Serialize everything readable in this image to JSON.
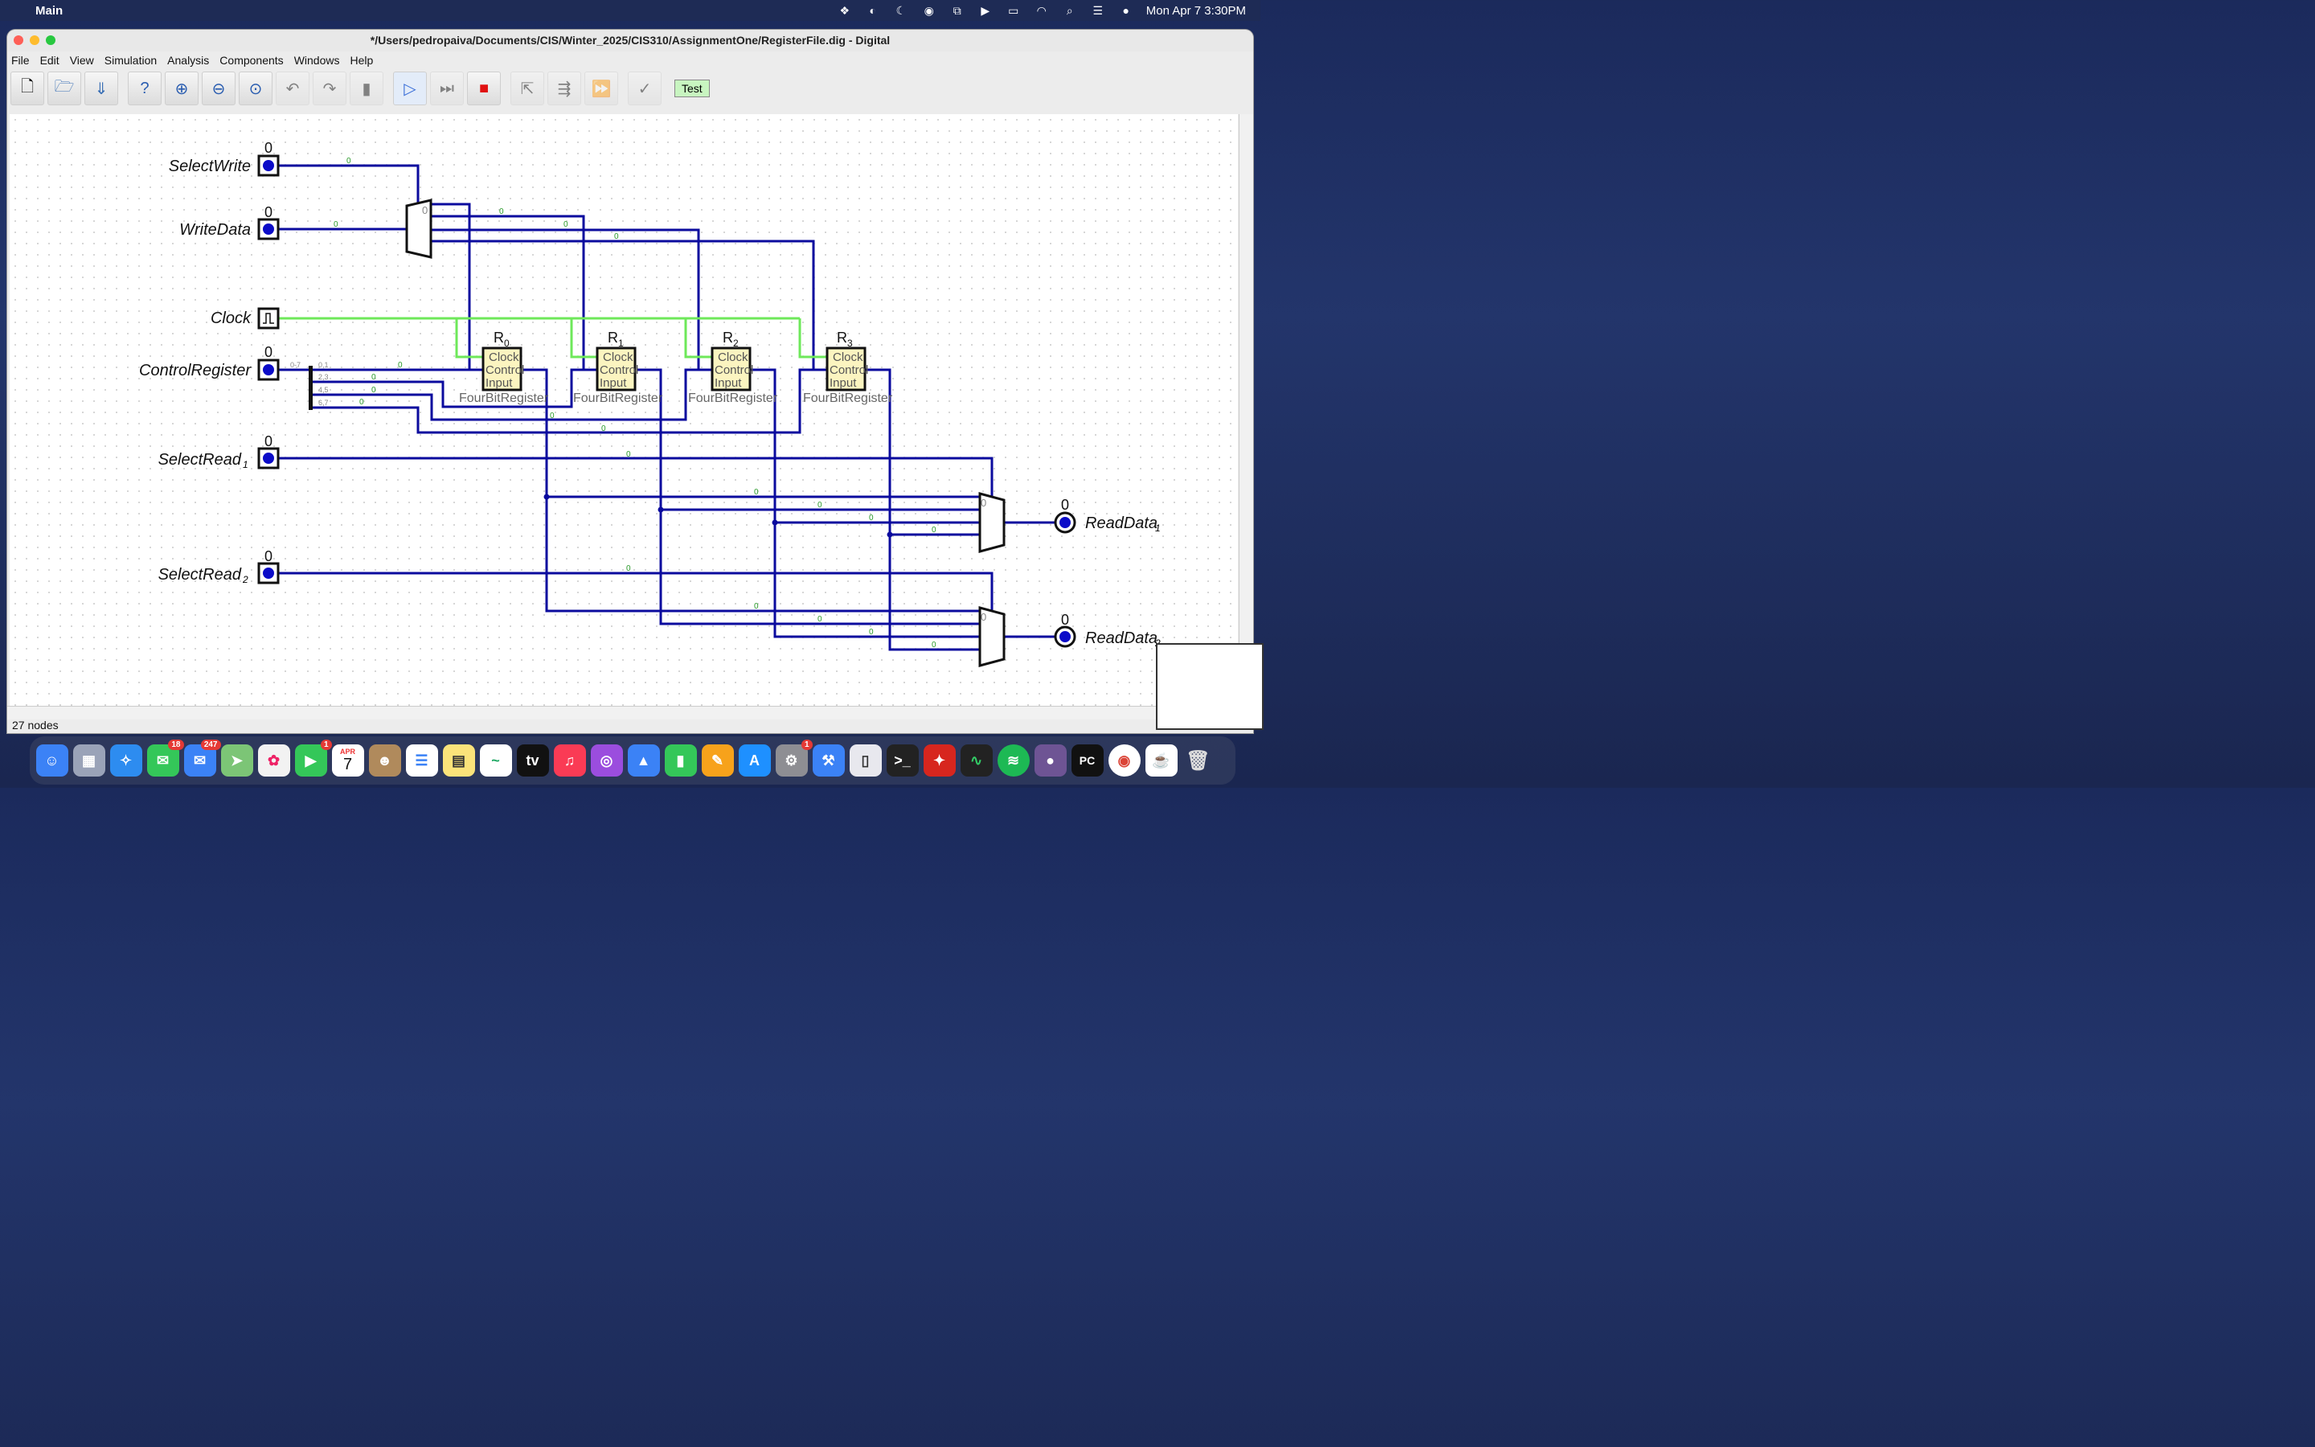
{
  "menubar": {
    "app_name": "Main",
    "datetime": "Mon Apr 7  3:30PM",
    "icons": [
      "dropbox-icon",
      "globe-icon",
      "moon-icon",
      "airdrop-icon",
      "screen-mirror-icon",
      "play-icon",
      "battery-icon",
      "wifi-icon",
      "search-icon",
      "control-center-icon",
      "siri-icon"
    ]
  },
  "window": {
    "title": "*/Users/pedropaiva/Documents/CIS/Winter_2025/CIS310/AssignmentOne/RegisterFile.dig - Digital"
  },
  "menu": [
    "File",
    "Edit",
    "View",
    "Simulation",
    "Analysis",
    "Components",
    "Windows",
    "Help"
  ],
  "toolbar": {
    "test_label": "Test",
    "buttons": [
      "new-file-icon",
      "open-folder-icon",
      "save-icon",
      "help-icon",
      "zoom-in-icon",
      "zoom-out-icon",
      "zoom-fit-icon",
      "undo-icon",
      "redo-icon",
      "delete-icon",
      "run-icon",
      "step-icon",
      "stop-icon",
      "select-icon",
      "fast-step-icon",
      "fast-forward-icon",
      "analyse-icon"
    ]
  },
  "circuit": {
    "inputs": {
      "select_write": "SelectWrite",
      "write_data": "WriteData",
      "clock": "Clock",
      "control_register": "ControlRegister",
      "select_read_1": "SelectRead",
      "select_read_1_sub": "1",
      "select_read_2": "SelectRead",
      "select_read_2_sub": "2"
    },
    "outputs": {
      "read_data_1": "ReadData",
      "read_data_1_sub": "1",
      "read_data_2": "ReadData",
      "read_data_2_sub": "2"
    },
    "value_zero": "0",
    "registers": [
      {
        "name": "R",
        "sub": "0"
      },
      {
        "name": "R",
        "sub": "1"
      },
      {
        "name": "R",
        "sub": "2"
      },
      {
        "name": "R",
        "sub": "3"
      }
    ],
    "register_type": "FourBitRegister",
    "port_clock": "Clock",
    "port_control": "Control",
    "port_input": "Input",
    "splitter_in": "0-7",
    "splitter_outs": [
      "0,1",
      "2,3",
      "4,5",
      "6,7"
    ]
  },
  "statusbar": {
    "nodes": "27 nodes"
  },
  "colors": {
    "wire": "#0b0b9e",
    "clock_wire": "#6ee85a",
    "register_fill": "#fbf4c0",
    "input_dot": "#0b0bc8"
  },
  "dock": {
    "apps": [
      {
        "name": "finder-icon",
        "badge": ""
      },
      {
        "name": "launchpad-icon",
        "badge": ""
      },
      {
        "name": "safari-icon",
        "badge": ""
      },
      {
        "name": "messages-icon",
        "badge": "18"
      },
      {
        "name": "mail-icon",
        "badge": "247"
      },
      {
        "name": "maps-icon",
        "badge": ""
      },
      {
        "name": "photos-icon",
        "badge": ""
      },
      {
        "name": "facetime-icon",
        "badge": "1"
      },
      {
        "name": "calendar-icon",
        "badge": ""
      },
      {
        "name": "contacts-icon",
        "badge": ""
      },
      {
        "name": "reminders-icon",
        "badge": ""
      },
      {
        "name": "notes-icon",
        "badge": ""
      },
      {
        "name": "freeform-icon",
        "badge": ""
      },
      {
        "name": "tv-icon",
        "badge": ""
      },
      {
        "name": "music-icon",
        "badge": ""
      },
      {
        "name": "podcasts-icon",
        "badge": ""
      },
      {
        "name": "keynote-icon",
        "badge": ""
      },
      {
        "name": "numbers-icon",
        "badge": ""
      },
      {
        "name": "pages-icon",
        "badge": ""
      },
      {
        "name": "app-store-icon",
        "badge": ""
      },
      {
        "name": "system-settings-icon",
        "badge": "1"
      },
      {
        "name": "xcode-icon",
        "badge": ""
      },
      {
        "name": "simulator-icon",
        "badge": ""
      },
      {
        "name": "terminal-icon",
        "badge": ""
      },
      {
        "name": "acrobat-icon",
        "badge": ""
      },
      {
        "name": "activity-monitor-icon",
        "badge": ""
      },
      {
        "name": "spotify-icon",
        "badge": ""
      },
      {
        "name": "github-icon",
        "badge": ""
      },
      {
        "name": "pycharm-icon",
        "badge": ""
      },
      {
        "name": "chrome-icon",
        "badge": ""
      },
      {
        "name": "java-icon",
        "badge": ""
      },
      {
        "name": "trash-icon",
        "badge": ""
      }
    ],
    "calendar_month": "APR",
    "calendar_day": "7",
    "tv_label": "tv",
    "pycharm_label": "PC"
  }
}
